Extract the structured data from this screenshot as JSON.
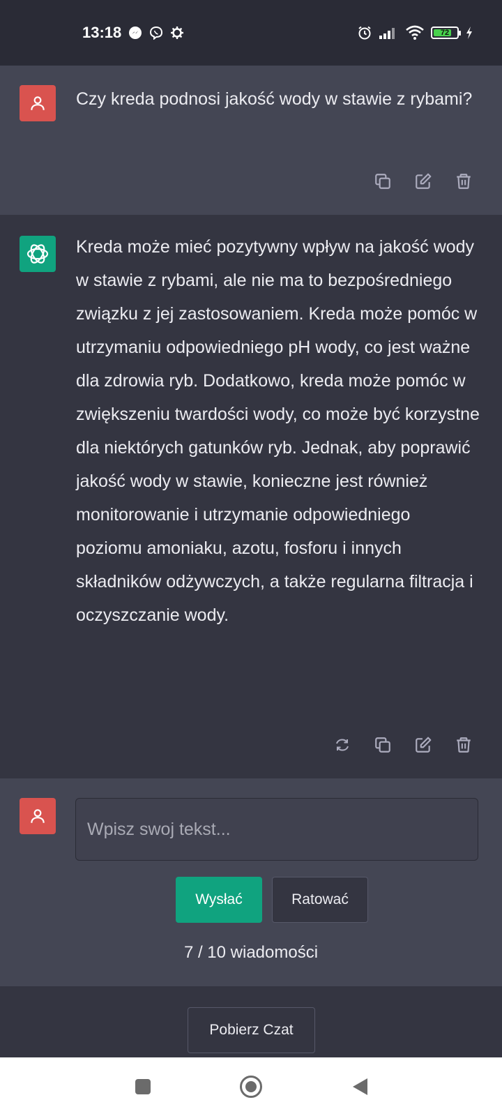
{
  "status_bar": {
    "time": "13:18",
    "left_icons": [
      "messenger-icon",
      "viber-icon",
      "settings-icon"
    ],
    "right_icons": [
      "alarm-icon",
      "signal-icon",
      "wifi-icon",
      "battery-icon",
      "charging-icon"
    ],
    "battery_level": "72"
  },
  "conversation": {
    "user_message": {
      "text": "Czy kreda podnosi jakość wody w stawie z rybami?",
      "actions": [
        "copy-icon",
        "edit-icon",
        "delete-icon"
      ]
    },
    "assistant_message": {
      "text": "Kreda może mieć pozytywny wpływ na jakość wody w stawie z rybami, ale nie ma to bezpośredniego związku z jej zastosowaniem. Kreda może pomóc w utrzymaniu odpowiedniego pH wody, co jest ważne dla zdrowia ryb. Dodatkowo, kreda może pomóc w zwiększeniu twardości wody, co może być korzystne dla niektórych gatunków ryb. Jednak, aby poprawić jakość wody w stawie, konieczne jest również monitorowanie i utrzymanie odpowiedniego poziomu amoniaku, azotu, fosforu i innych składników odżywczych, a także regularna filtracja i oczyszczanie wody.",
      "actions": [
        "regenerate-icon",
        "copy-icon",
        "edit-icon",
        "delete-icon"
      ]
    }
  },
  "composer": {
    "placeholder": "Wpisz swoj tekst...",
    "send_label": "Wysłać",
    "save_label": "Ratować",
    "counter": "7 / 10 wiadomości"
  },
  "footer": {
    "download_label": "Pobierz Czat"
  },
  "colors": {
    "background": "#343541",
    "user_message_bg": "#444654",
    "user_avatar": "#d9534f",
    "assistant_avatar": "#10a37f",
    "send_button": "#10a37f"
  }
}
